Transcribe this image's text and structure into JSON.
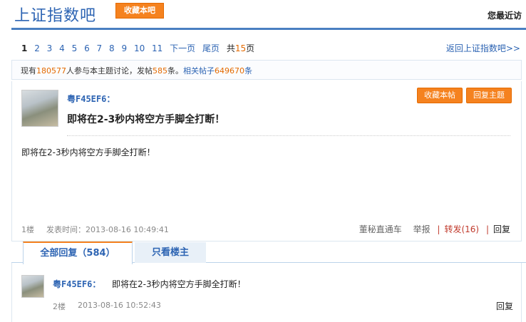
{
  "header": {
    "title": "上证指数吧",
    "fav_bar_label": "收藏本吧",
    "recent_label": "您最近访"
  },
  "pager": {
    "pages": [
      "1",
      "2",
      "3",
      "4",
      "5",
      "6",
      "7",
      "8",
      "9",
      "10",
      "11"
    ],
    "current": "1",
    "next": "下一页",
    "last": "尾页",
    "total_prefix": "共",
    "total": "15",
    "total_suffix": "页",
    "back_link": "返回上证指数吧>>"
  },
  "stats": {
    "p1": "现有",
    "participants": "180577",
    "p2": "人参与本主题讨论，发帖",
    "posts": "585",
    "p3": "条。",
    "p4": "相关帖子",
    "related": "649670",
    "p5": "条"
  },
  "post": {
    "username": "粤F45EF6：",
    "title": "即将在2-3秒内将空方手脚全打断！",
    "content": "即将在2-3秒内将空方手脚全打断！",
    "fav_label": "收藏本帖",
    "reply_label": "回复主题",
    "floor": "1楼",
    "time": "发表时间：2013-08-16 10:49:41",
    "actions": {
      "dm": "董秘直通车",
      "report": "举报",
      "repost": "转发(16)",
      "reply": "回复"
    }
  },
  "tabs": {
    "all": "全部回复（584）",
    "owner": "只看楼主"
  },
  "replies": [
    {
      "username": "粤F45EF6：",
      "text": "即将在2-3秒内将空方手脚全打断！",
      "floor": "2楼",
      "time": "2013-08-16 10:52:43",
      "reply": "回复"
    }
  ]
}
